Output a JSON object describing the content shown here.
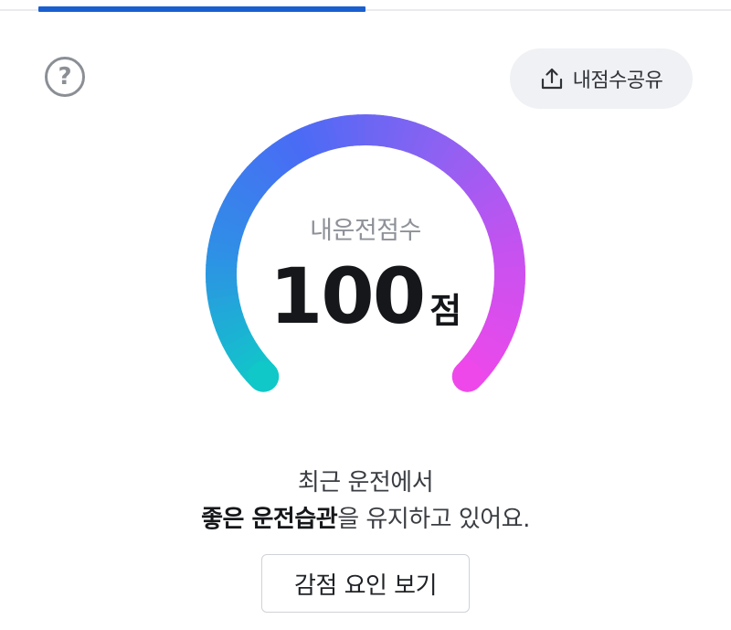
{
  "tabs": {
    "active_index": 0
  },
  "header": {
    "help_icon_label": "?",
    "share_icon": "upload-icon",
    "share_label": "내점수공유"
  },
  "gauge": {
    "title": "내운전점수",
    "score": "100",
    "unit": "점",
    "level_fraction": 1.0,
    "gradient_colors": [
      "#10c8c8",
      "#2f8fe6",
      "#4a6bf5",
      "#8a62f2",
      "#c652f0",
      "#ee48ea"
    ]
  },
  "message": {
    "line1": "최근 운전에서",
    "line2_bold": "좋은 운전습관",
    "line2_rest": "을 유지하고 있어요."
  },
  "factor_button": {
    "label": "감점 요인 보기"
  }
}
